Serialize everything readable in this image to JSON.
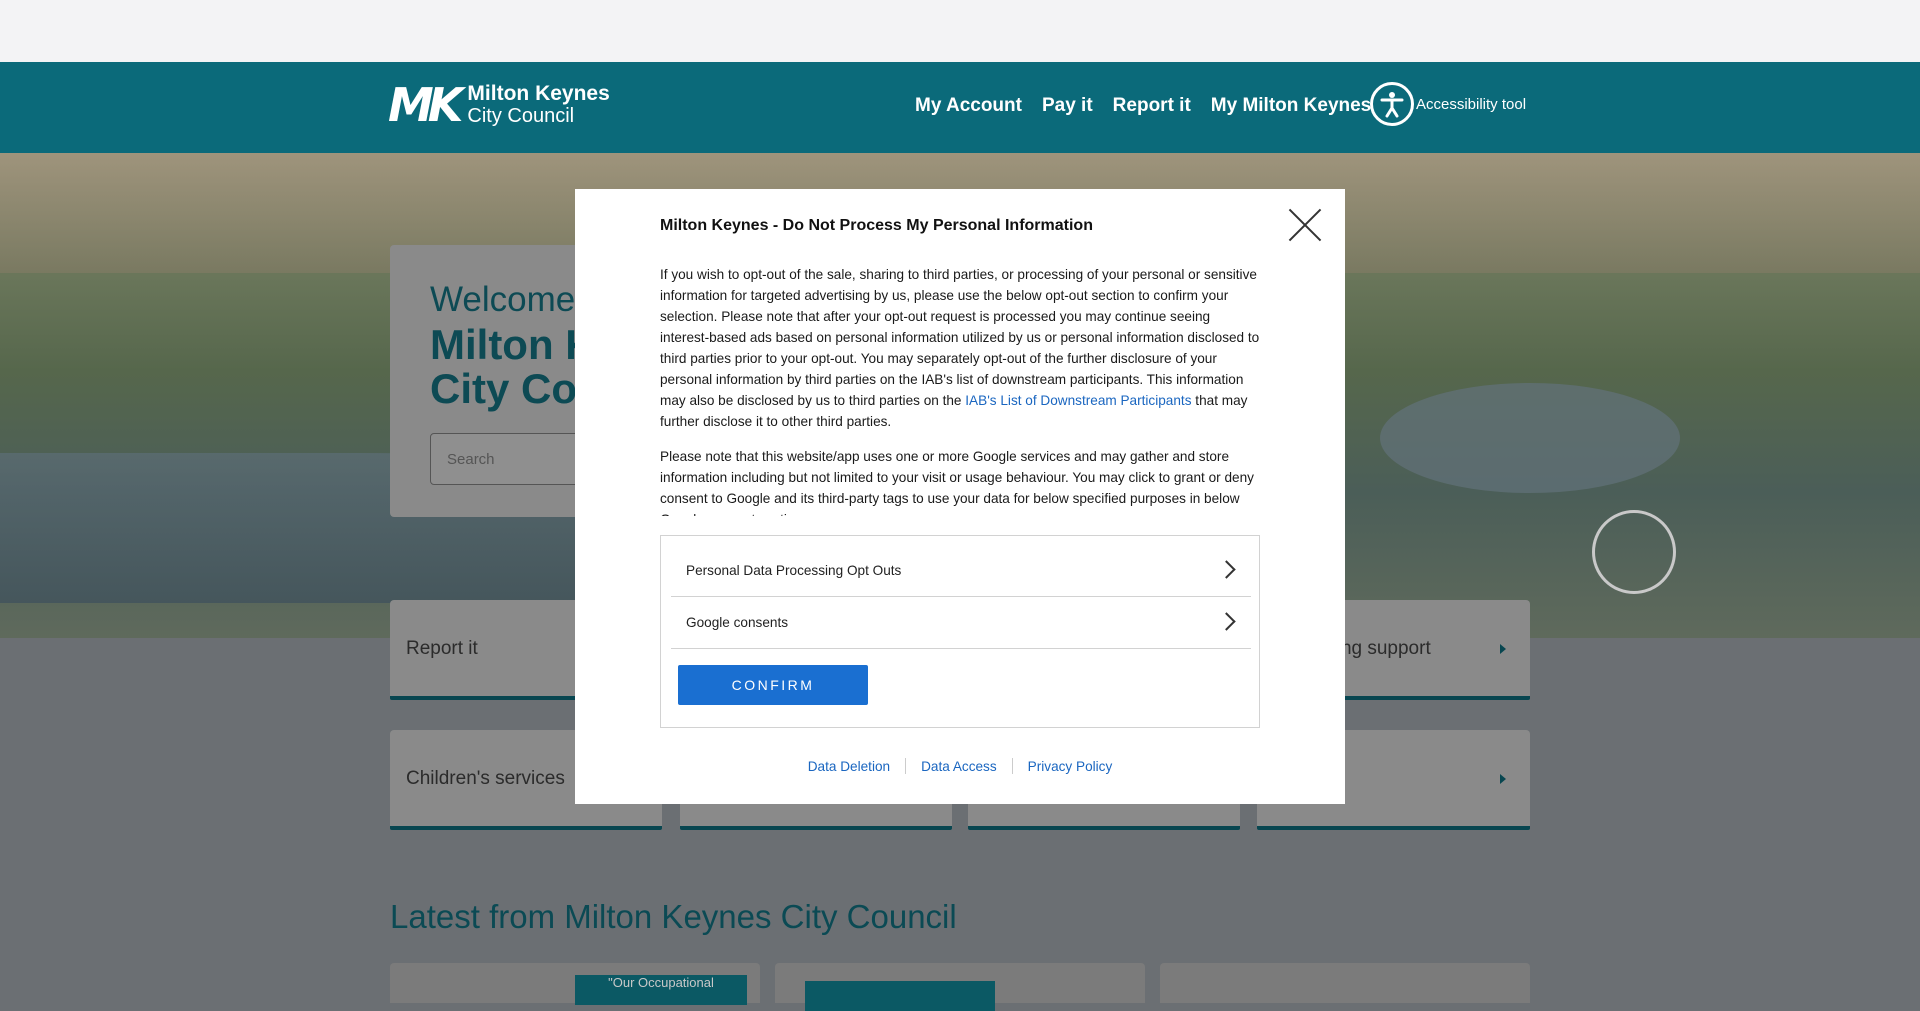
{
  "header": {
    "logo_mark": "MK",
    "logo_line1": "Milton Keynes",
    "logo_line2": "City Council",
    "nav": [
      "My Account",
      "Pay it",
      "Report it",
      "My Milton Keynes"
    ],
    "accessibility_label": "Accessibility tool"
  },
  "hero": {
    "welcome_line1": "Welcome t",
    "welcome_line2": "Milton K",
    "welcome_line3": "City Cou",
    "search_placeholder": "Search"
  },
  "tiles": {
    "report_it": "Report it",
    "living_support": "iving support",
    "childrens_services": "Children's services"
  },
  "latest": {
    "heading": "Latest from Milton Keynes City Council",
    "card1_badge": "\"Our Occupational"
  },
  "modal": {
    "title": "Milton Keynes - Do Not Process My Personal Information",
    "para1_text": "If you wish to opt-out of the sale, sharing to third parties, or processing of your personal or sensitive information for targeted advertising by us, please use the below opt-out section to confirm your selection. Please note that after your opt-out request is processed you may continue seeing interest-based ads based on personal information utilized by us or personal information disclosed to third parties prior to your opt-out. You may separately opt-out of the further disclosure of your personal information by third parties on the IAB's list of downstream participants. This information may also be disclosed by us to third parties on the ",
    "para1_link": "IAB's List of Downstream Participants",
    "para1_tail": " that may further disclose it to other third parties.",
    "para2_text": "Please note that this website/app uses one or more Google services and may gather and store information including but not limited to your visit or usage behaviour. You may click to grant or deny consent to Google and its third-party tags to use your data for below specified purposes in below Google consent section.",
    "row1": "Personal Data Processing Opt Outs",
    "row2": "Google consents",
    "confirm": "CONFIRM",
    "links": [
      "Data Deletion",
      "Data Access",
      "Privacy Policy"
    ]
  }
}
